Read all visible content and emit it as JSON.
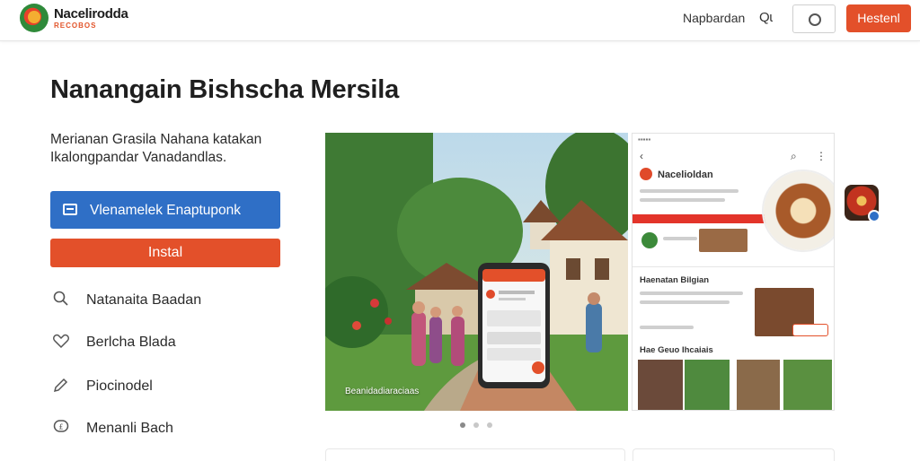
{
  "header": {
    "brand_name": "Nacelirodda",
    "brand_tagline": "RECOBOS",
    "nav_link": "Napbardan",
    "search_label": "Qɩ",
    "cta_label": "Hestenl"
  },
  "main": {
    "title": "Nanangain Bishscha Mersila",
    "description": "Merianan Grasila Nahana katakan Ikalongpandar Vanadandlas.",
    "primary_button_label": "Vlenamelek Enaptuponk",
    "install_button_label": "Instal",
    "features": [
      {
        "icon": "search-icon",
        "label": "Natanaita Baadan"
      },
      {
        "icon": "heart-icon",
        "label": "Berlcha Blada"
      },
      {
        "icon": "pen-icon",
        "label": "Piocinodel"
      },
      {
        "icon": "chat-icon",
        "label": "Menanli Bach"
      }
    ]
  },
  "media": {
    "photo_caption": "Beanidadiaraciaas",
    "mockup_brand": "Nacelioldan",
    "mockup_section_1": "Haenatan Bilgian",
    "mockup_section_2": "Hae Geuo Ihcaiais",
    "carousel_pages": 3,
    "carousel_active": 1
  }
}
